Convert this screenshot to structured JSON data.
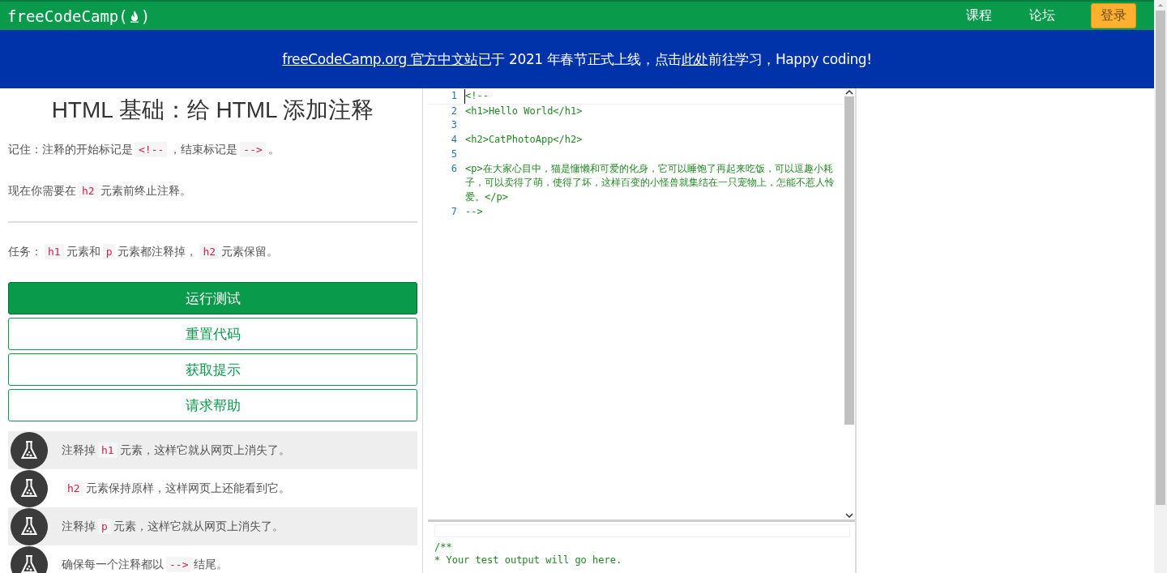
{
  "nav": {
    "logo": {
      "before": "freeCodeCamp(",
      "after": ")"
    },
    "links": [
      "课程",
      "论坛"
    ],
    "login": "登录"
  },
  "banner": {
    "parts": [
      {
        "kind": "link",
        "text": "freeCodeCamp.org 官方中文站"
      },
      {
        "kind": "text",
        "text": "已于 2021 年春节正式上线，点击"
      },
      {
        "kind": "link",
        "text": "此处"
      },
      {
        "kind": "text",
        "text": "前往学习，Happy coding!"
      }
    ]
  },
  "challenge": {
    "title": "HTML 基础：给 HTML 添加注释",
    "paragraphs": [
      [
        {
          "kind": "text",
          "text": "记住：注释的开始标记是"
        },
        {
          "kind": "code",
          "text": "<!--"
        },
        {
          "kind": "text",
          "text": "，结束标记是"
        },
        {
          "kind": "code",
          "text": "-->"
        },
        {
          "kind": "text",
          "text": "。"
        }
      ],
      [
        {
          "kind": "text",
          "text": "现在你需要在"
        },
        {
          "kind": "code",
          "text": "h2"
        },
        {
          "kind": "text",
          "text": "元素前终止注释。"
        }
      ]
    ],
    "task": [
      {
        "kind": "text",
        "text": "任务："
      },
      {
        "kind": "code",
        "text": "h1"
      },
      {
        "kind": "text",
        "text": "元素和"
      },
      {
        "kind": "code",
        "text": "p"
      },
      {
        "kind": "text",
        "text": "元素都注释掉，"
      },
      {
        "kind": "code",
        "text": "h2"
      },
      {
        "kind": "text",
        "text": "元素保留。"
      }
    ],
    "buttons": [
      {
        "kind": "primary",
        "label": "运行测试"
      },
      {
        "kind": "secondary",
        "label": "重置代码"
      },
      {
        "kind": "secondary",
        "label": "获取提示"
      },
      {
        "kind": "secondary",
        "label": "请求帮助"
      }
    ],
    "tests": [
      [
        {
          "kind": "text",
          "text": "注释掉"
        },
        {
          "kind": "code",
          "text": "h1"
        },
        {
          "kind": "text",
          "text": "元素，这样它就从网页上消失了。"
        }
      ],
      [
        {
          "kind": "code",
          "text": "h2"
        },
        {
          "kind": "text",
          "text": "元素保持原样，这样网页上还能看到它。"
        }
      ],
      [
        {
          "kind": "text",
          "text": "注释掉"
        },
        {
          "kind": "code",
          "text": "p"
        },
        {
          "kind": "text",
          "text": "元素，这样它就从网页上消失了。"
        }
      ],
      [
        {
          "kind": "text",
          "text": "确保每一个注释都以"
        },
        {
          "kind": "code",
          "text": "-->"
        },
        {
          "kind": "text",
          "text": "结尾。"
        }
      ]
    ]
  },
  "editor": {
    "lines": [
      {
        "number": "1",
        "code": "<!--"
      },
      {
        "number": "2",
        "code": "<h1>Hello World</h1>"
      },
      {
        "number": "3"
      },
      {
        "number": "4",
        "code": "<h2>CatPhotoApp</h2>"
      },
      {
        "number": "5"
      },
      {
        "number": "6",
        "code": "<p>在大家心目中，猫是慵懒和可爱的化身，它可以睡饱了再起来吃饭，可以逗趣小耗子，可以卖得了萌，使得了坏，这样百变的小怪兽就集结在一只宠物上，怎能不惹人怜爱。</p>"
      },
      {
        "number": "7",
        "code": "-->"
      }
    ]
  },
  "output": {
    "lines": [
      "/**",
      "* Your test output will go here."
    ]
  }
}
